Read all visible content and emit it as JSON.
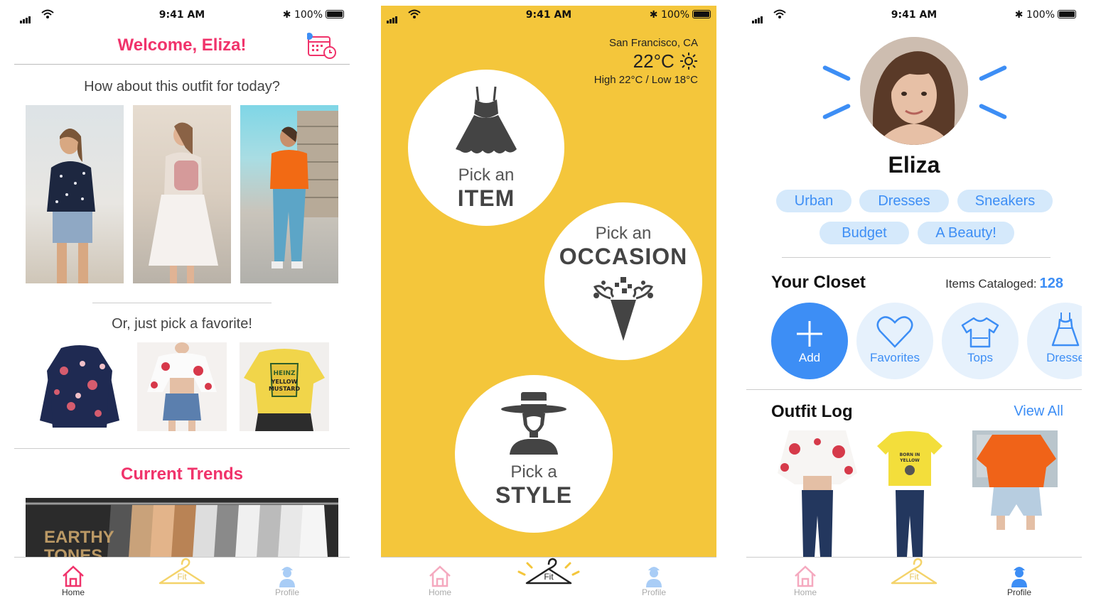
{
  "status_bar": {
    "time": "9:41 AM",
    "battery": "100%"
  },
  "home": {
    "title": "Welcome, Eliza!",
    "outfit_prompt": "How about this outfit for today?",
    "favorite_prompt": "Or, just pick a favorite!",
    "trends_title": "Current Trends",
    "trend_banner_text": "EARTHY TONES"
  },
  "fit": {
    "weather": {
      "city": "San Francisco, CA",
      "temperature": "22°C",
      "high_low": "High 22°C / Low 18°C"
    },
    "options": [
      {
        "small": "Pick an",
        "big": "ITEM",
        "icon": "dress-icon"
      },
      {
        "small": "Pick an",
        "big": "OCCASION",
        "icon": "bouquet-icon"
      },
      {
        "small": "Pick a",
        "big": "STYLE",
        "icon": "hat-woman-icon"
      }
    ]
  },
  "profile": {
    "name": "Eliza",
    "tags": [
      "Urban",
      "Dresses",
      "Sneakers",
      "Budget",
      "A Beauty!"
    ],
    "closet_title": "Your Closet",
    "items_cataloged_label": "Items Cataloged:",
    "items_cataloged_count": "128",
    "closet_buttons": [
      "Add",
      "Favorites",
      "Tops",
      "Dresse"
    ],
    "outfit_log_title": "Outfit Log",
    "view_all": "View All"
  },
  "tabs": {
    "home": "Home",
    "fit": "Fit",
    "profile": "Profile"
  },
  "colors": {
    "pink": "#f0336b",
    "yellow": "#f4c63b",
    "blue": "#3d8ef5"
  }
}
